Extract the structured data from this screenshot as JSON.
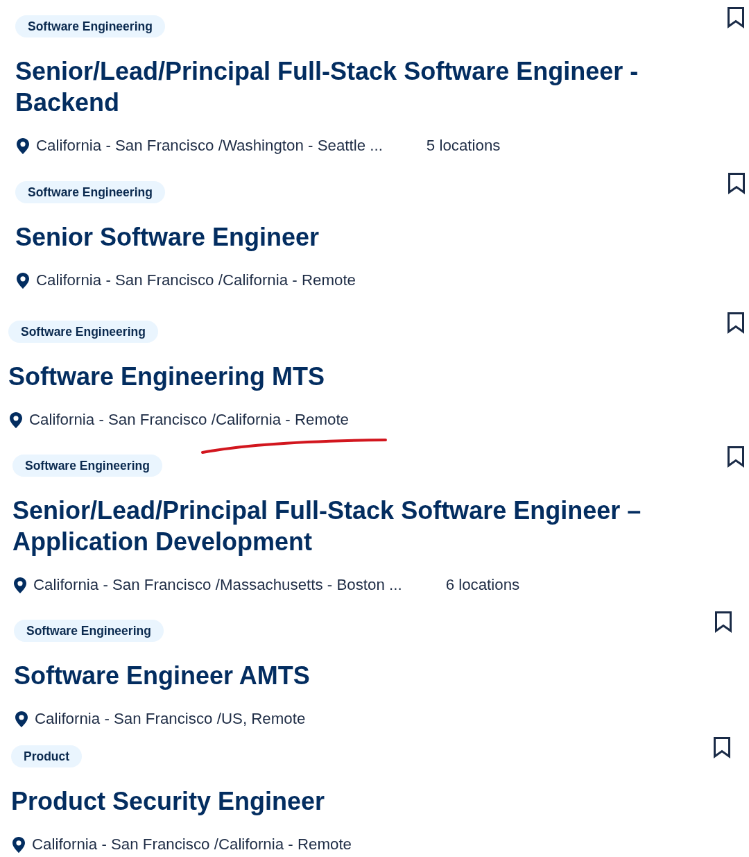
{
  "jobs": [
    {
      "category": "Software Engineering",
      "title": "Senior/Lead/Principal Full-Stack Software Engineer - Backend",
      "locations": "California - San Francisco /Washington - Seattle ...",
      "location_count": "5 locations",
      "saved": false,
      "underlined": false
    },
    {
      "category": "Software Engineering",
      "title": "Senior Software Engineer",
      "locations": "California - San Francisco /California - Remote",
      "saved": false,
      "underlined": false
    },
    {
      "category": "Software Engineering",
      "title": "Software Engineering MTS",
      "locations": "California - San Francisco /California - Remote",
      "saved": false,
      "underlined": true
    },
    {
      "category": "Software Engineering",
      "title": "Senior/Lead/Principal Full-Stack Software Engineer – Application Development",
      "locations": "California - San Francisco /Massachusetts - Boston ...",
      "location_count": "6 locations",
      "saved": false,
      "underlined": false
    },
    {
      "category": "Software Engineering",
      "title": "Software Engineer AMTS",
      "locations": "California - San Francisco /US, Remote",
      "saved": false,
      "underlined": false
    },
    {
      "category": "Product",
      "title": "Product Security Engineer",
      "locations": "California - San Francisco /California - Remote",
      "saved": false,
      "underlined": false
    }
  ]
}
